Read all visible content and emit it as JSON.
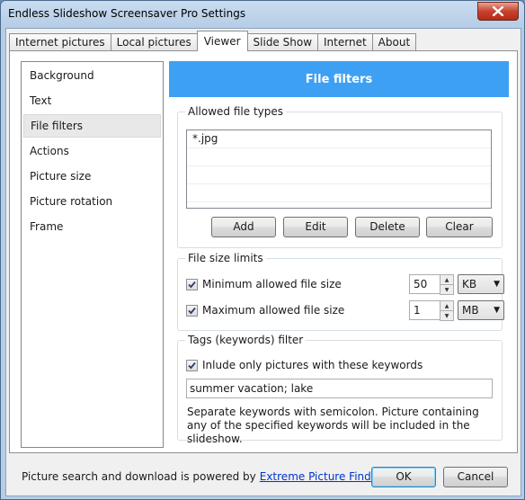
{
  "window": {
    "title": "Endless Slideshow Screensaver Pro Settings"
  },
  "tabs": [
    {
      "label": "Internet pictures",
      "active": false
    },
    {
      "label": "Local pictures",
      "active": false
    },
    {
      "label": "Viewer",
      "active": true
    },
    {
      "label": "Slide Show",
      "active": false
    },
    {
      "label": "Internet",
      "active": false
    },
    {
      "label": "About",
      "active": false
    }
  ],
  "sidebar": {
    "items": [
      {
        "label": "Background",
        "selected": false
      },
      {
        "label": "Text",
        "selected": false
      },
      {
        "label": "File filters",
        "selected": true
      },
      {
        "label": "Actions",
        "selected": false
      },
      {
        "label": "Picture size",
        "selected": false
      },
      {
        "label": "Picture rotation",
        "selected": false
      },
      {
        "label": "Frame",
        "selected": false
      }
    ]
  },
  "header": {
    "title": "File filters",
    "color": "#3ea0f3"
  },
  "file_types": {
    "label": "Allowed file types",
    "items": [
      "*.jpg"
    ],
    "buttons": {
      "add": "Add",
      "edit": "Edit",
      "delete": "Delete",
      "clear": "Clear"
    }
  },
  "size_limits": {
    "label": "File size limits",
    "min": {
      "label": "Minimum allowed file size",
      "checked": true,
      "value": "50",
      "unit": "KB"
    },
    "max": {
      "label": "Maximum allowed file size",
      "checked": true,
      "value": "1",
      "unit": "MB"
    }
  },
  "tags": {
    "label": "Tags (keywords) filter",
    "checkbox_label": "Inlude only pictures with these keywords",
    "checked": true,
    "value": "summer vacation; lake",
    "hint": "Separate keywords with semicolon. Picture containing any of the specified keywords will be included in the slideshow."
  },
  "footer": {
    "text": "Picture search and download is powered by",
    "link": "Extreme Picture Finder",
    "ok": "OK",
    "cancel": "Cancel"
  }
}
